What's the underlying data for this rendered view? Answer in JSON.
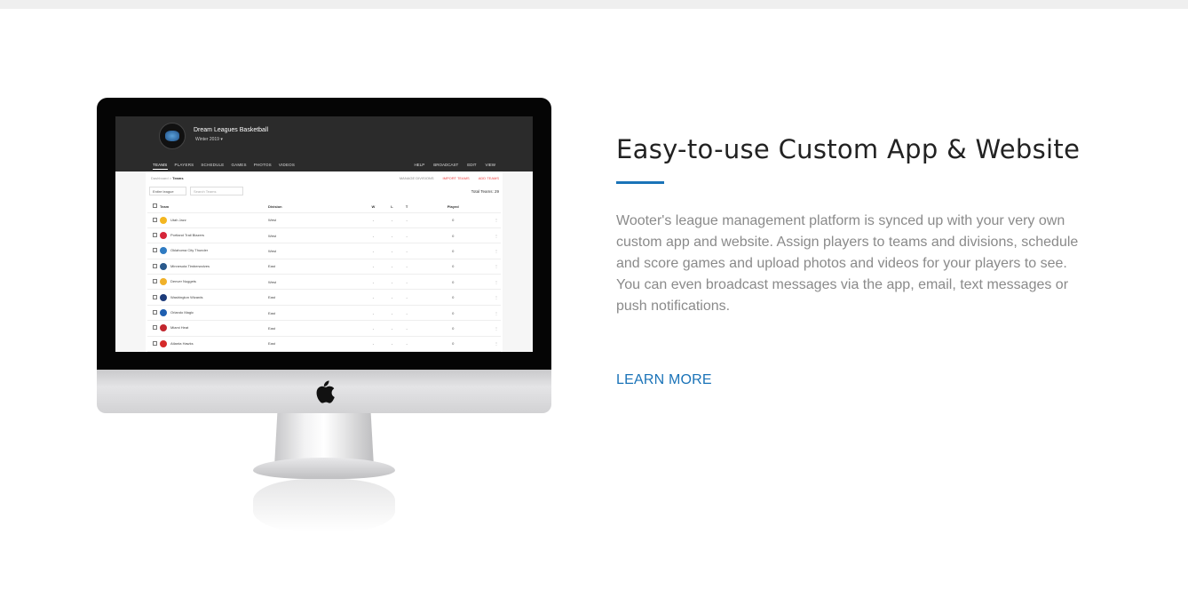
{
  "app": {
    "league_name": "Dream Leagues Basketball",
    "season": "Winter 2019 ▾",
    "tabs": [
      "TEAMS",
      "PLAYERS",
      "SCHEDULE",
      "GAMES",
      "PHOTOS",
      "VIDEOS"
    ],
    "right_nav": [
      "HELP",
      "BROADCAST",
      "EDIT",
      "VIEW"
    ],
    "breadcrumb_parent": "Dashboard",
    "breadcrumb_sep": ">",
    "breadcrumb_current": "Teams",
    "manage_label": "MANAGE DIVISIONS",
    "import_label": "IMPORT TEAMS",
    "add_label": "ADD TEAMS",
    "filter_value": "Entire league",
    "search_placeholder": "Search Teams",
    "total_label": "Total Teams: 29",
    "columns": [
      "Team",
      "Division",
      "W",
      "L",
      "T",
      "Played"
    ],
    "rows": [
      {
        "team": "Utah Jazz",
        "division": "West",
        "w": "-",
        "l": "-",
        "t": "-",
        "played": "0",
        "color": "#f3b620"
      },
      {
        "team": "Portland Trail Blazers",
        "division": "West",
        "w": "-",
        "l": "-",
        "t": "-",
        "played": "0",
        "color": "#d6263a"
      },
      {
        "team": "Oklahoma City Thunder",
        "division": "West",
        "w": "-",
        "l": "-",
        "t": "-",
        "played": "0",
        "color": "#2f7bc2"
      },
      {
        "team": "Minnesota Timberwolves",
        "division": "East",
        "w": "-",
        "l": "-",
        "t": "-",
        "played": "0",
        "color": "#2a5a8c"
      },
      {
        "team": "Denver Nuggets",
        "division": "West",
        "w": "-",
        "l": "-",
        "t": "-",
        "played": "0",
        "color": "#f0b12a"
      },
      {
        "team": "Washington Wizards",
        "division": "East",
        "w": "-",
        "l": "-",
        "t": "-",
        "played": "0",
        "color": "#1c3b7a"
      },
      {
        "team": "Orlando Magic",
        "division": "East",
        "w": "-",
        "l": "-",
        "t": "-",
        "played": "0",
        "color": "#1f5fb0"
      },
      {
        "team": "Miami Heat",
        "division": "East",
        "w": "-",
        "l": "-",
        "t": "-",
        "played": "0",
        "color": "#c2262e"
      },
      {
        "team": "Atlanta Hawks",
        "division": "East",
        "w": "-",
        "l": "-",
        "t": "-",
        "played": "0",
        "color": "#d52a2a"
      }
    ]
  },
  "section": {
    "headline": "Easy-to-use Custom App & Website",
    "body": "Wooter's league management platform is synced up with your very own custom app and website. Assign players to teams and divisions, schedule and score games and upload photos and videos for your players to see. You can even broadcast messages via the app, email, text messages or push notifications.",
    "cta": "LEARN MORE",
    "accent": "#1a73b8"
  }
}
